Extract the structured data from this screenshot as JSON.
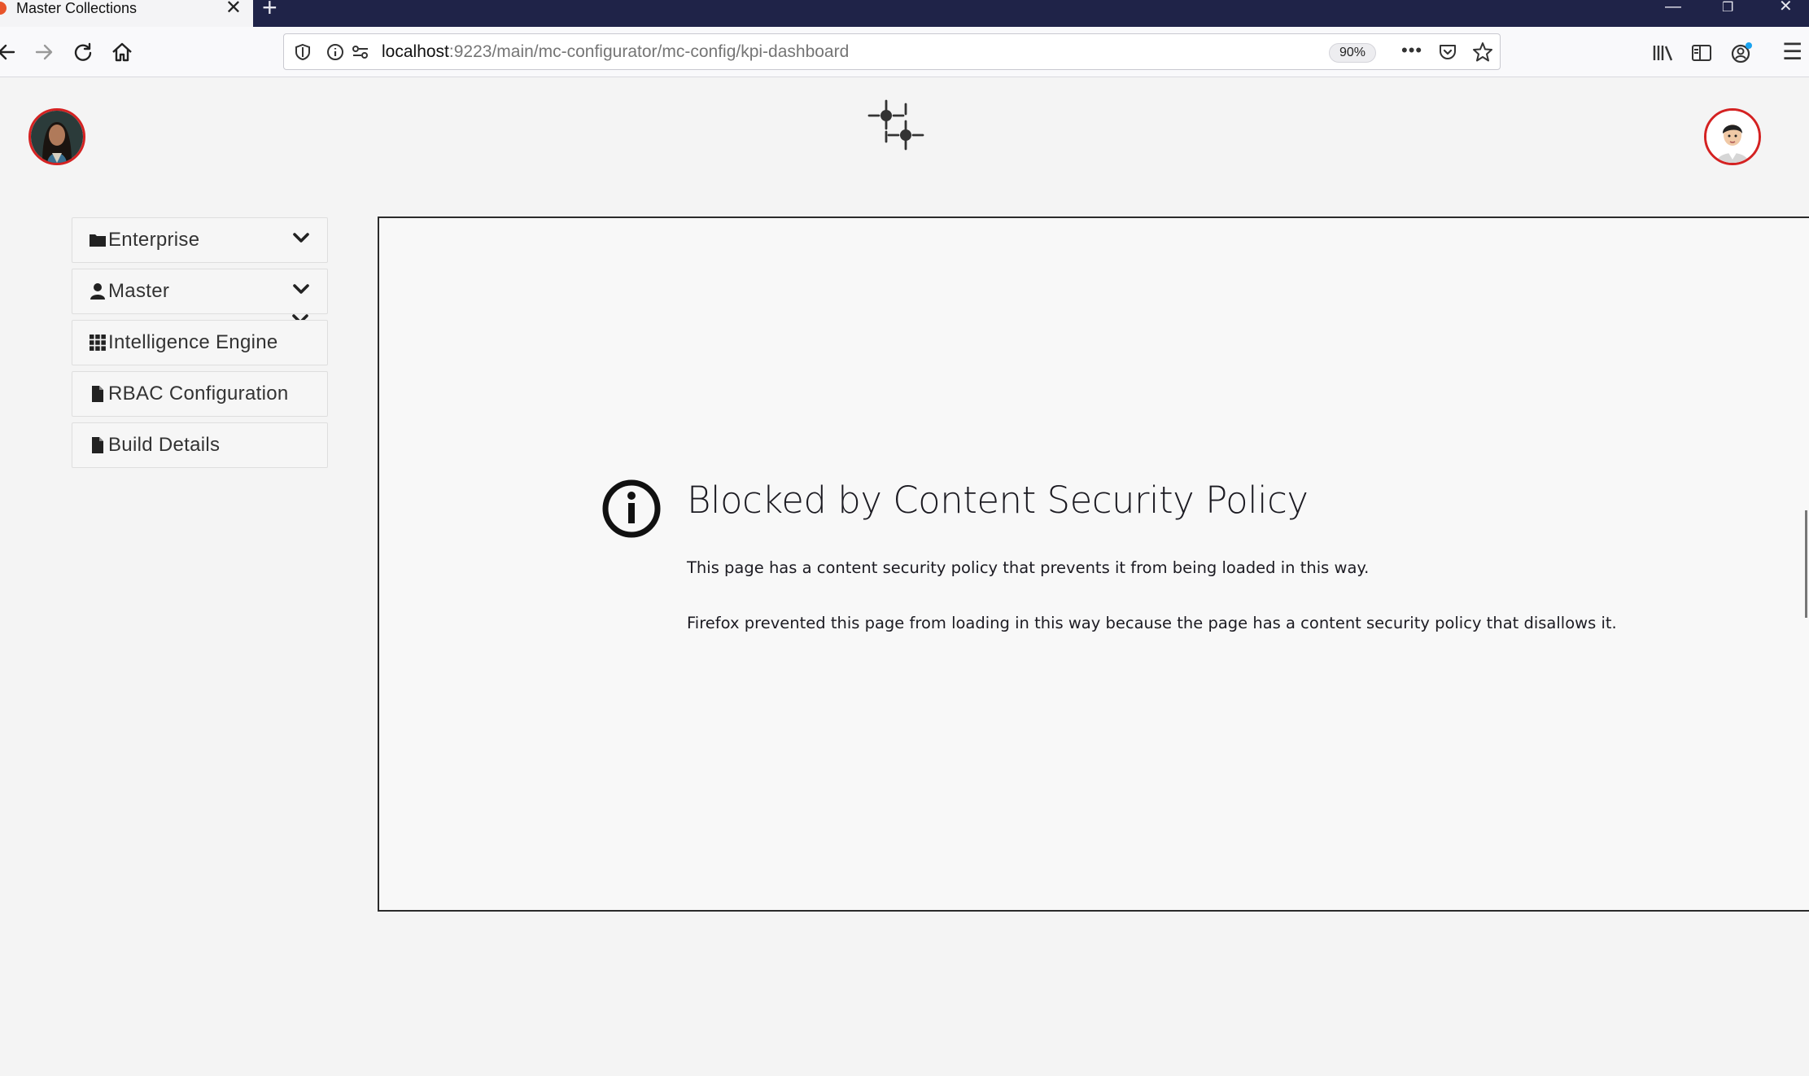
{
  "browser": {
    "tab_title": "Master Collections",
    "tab_close": "✕",
    "new_tab": "+",
    "window_controls": {
      "minimize": "—",
      "restore": "❐",
      "close": "✕"
    },
    "url_host": "localhost",
    "url_rest": ":9223/main/mc-configurator/mc-config/kpi-dashboard",
    "zoom": "90%",
    "page_actions": "•••",
    "menu_icon": "☰"
  },
  "sidebar": {
    "items": [
      {
        "label": "Enterprise",
        "icon": "folder-icon",
        "expandable": true
      },
      {
        "label": "Master",
        "icon": "user-icon",
        "expandable": true
      },
      {
        "label": "Intelligence Engine",
        "icon": "grid-icon",
        "expandable": false
      },
      {
        "label": "RBAC Configuration",
        "icon": "file-icon",
        "expandable": false
      },
      {
        "label": "Build Details",
        "icon": "file-icon",
        "expandable": false
      }
    ]
  },
  "error": {
    "title": "Blocked by Content Security Policy",
    "message": "This page has a content security policy that prevents it from being loaded in this way.",
    "detail": "Firefox prevented this page from loading in this way because the page has a content security policy that disallows it."
  },
  "colors": {
    "tabstrip": "#1f2348",
    "avatar_ring": "#d42222",
    "frame_border": "#2b2b2b"
  }
}
